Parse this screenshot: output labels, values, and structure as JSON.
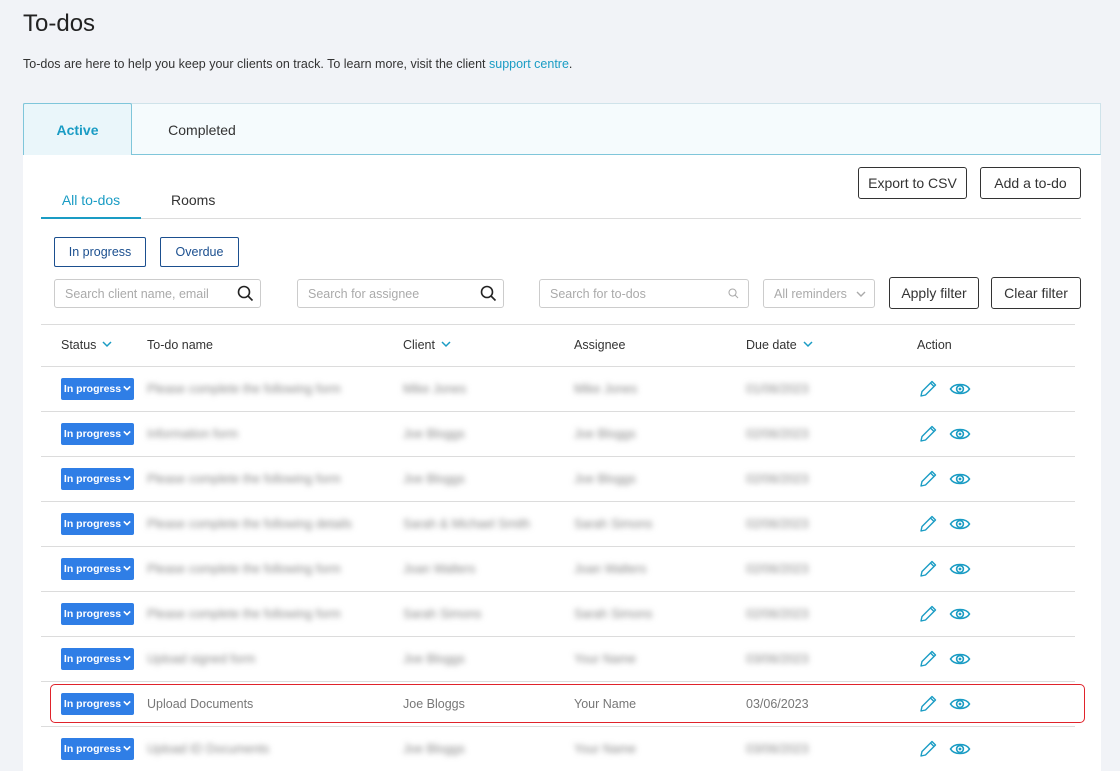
{
  "page": {
    "title": "To-dos",
    "intro_text": "To-dos are here to help you keep your clients on track. To learn more, visit the client",
    "intro_link": "support centre",
    "intro_end": "."
  },
  "main_tabs": [
    {
      "label": "Active",
      "active": true
    },
    {
      "label": "Completed",
      "active": false
    }
  ],
  "sub_tabs": [
    {
      "label": "All to-dos",
      "active": true
    },
    {
      "label": "Rooms",
      "active": false
    }
  ],
  "toolbar": {
    "export_label": "Export to CSV",
    "add_label": "Add a to-do"
  },
  "filters": {
    "chip_in_progress": "In progress",
    "chip_overdue": "Overdue",
    "client_placeholder": "Search client name, email",
    "assignee_placeholder": "Search for assignee",
    "todo_placeholder": "Search for to-dos",
    "reminders_value": "All reminders",
    "apply_label": "Apply filter",
    "clear_label": "Clear filter"
  },
  "table": {
    "headers": {
      "status": "Status",
      "name": "To-do name",
      "client": "Client",
      "assignee": "Assignee",
      "due": "Due date",
      "action": "Action"
    },
    "rows": [
      {
        "status": "In progress",
        "name": "Please complete the following form",
        "client": "Mike Jones",
        "assignee": "Mike Jones",
        "due": "01/06/2023",
        "blurred": true
      },
      {
        "status": "In progress",
        "name": "Information form",
        "client": "Joe Bloggs",
        "assignee": "Joe Bloggs",
        "due": "02/06/2023",
        "blurred": true
      },
      {
        "status": "In progress",
        "name": "Please complete the following form",
        "client": "Joe Bloggs",
        "assignee": "Joe Bloggs",
        "due": "02/06/2023",
        "blurred": true
      },
      {
        "status": "In progress",
        "name": "Please complete the following details",
        "client": "Sarah & Michael Smith",
        "assignee": "Sarah Simons",
        "due": "02/06/2023",
        "blurred": true
      },
      {
        "status": "In progress",
        "name": "Please complete the following form",
        "client": "Joan Walters",
        "assignee": "Joan Walters",
        "due": "02/06/2023",
        "blurred": true
      },
      {
        "status": "In progress",
        "name": "Please complete the following form",
        "client": "Sarah Simons",
        "assignee": "Sarah Simons",
        "due": "02/06/2023",
        "blurred": true
      },
      {
        "status": "In progress",
        "name": "Upload signed form",
        "client": "Joe Bloggs",
        "assignee": "Your Name",
        "due": "03/06/2023",
        "blurred": true
      },
      {
        "status": "In progress",
        "name": "Upload Documents",
        "client": "Joe Bloggs",
        "assignee": "Your Name",
        "due": "03/06/2023",
        "blurred": false
      },
      {
        "status": "In progress",
        "name": "Upload ID Documents",
        "client": "Joe Bloggs",
        "assignee": "Your Name",
        "due": "03/06/2023",
        "blurred": true
      }
    ]
  },
  "colors": {
    "accent": "#1a9cc4",
    "status_button": "#2f7ee6",
    "chip_border": "#1b4f8f",
    "highlight": "#e0232b"
  },
  "icons": [
    "search-icon",
    "chevron-down-icon",
    "pencil-icon",
    "eye-icon"
  ]
}
